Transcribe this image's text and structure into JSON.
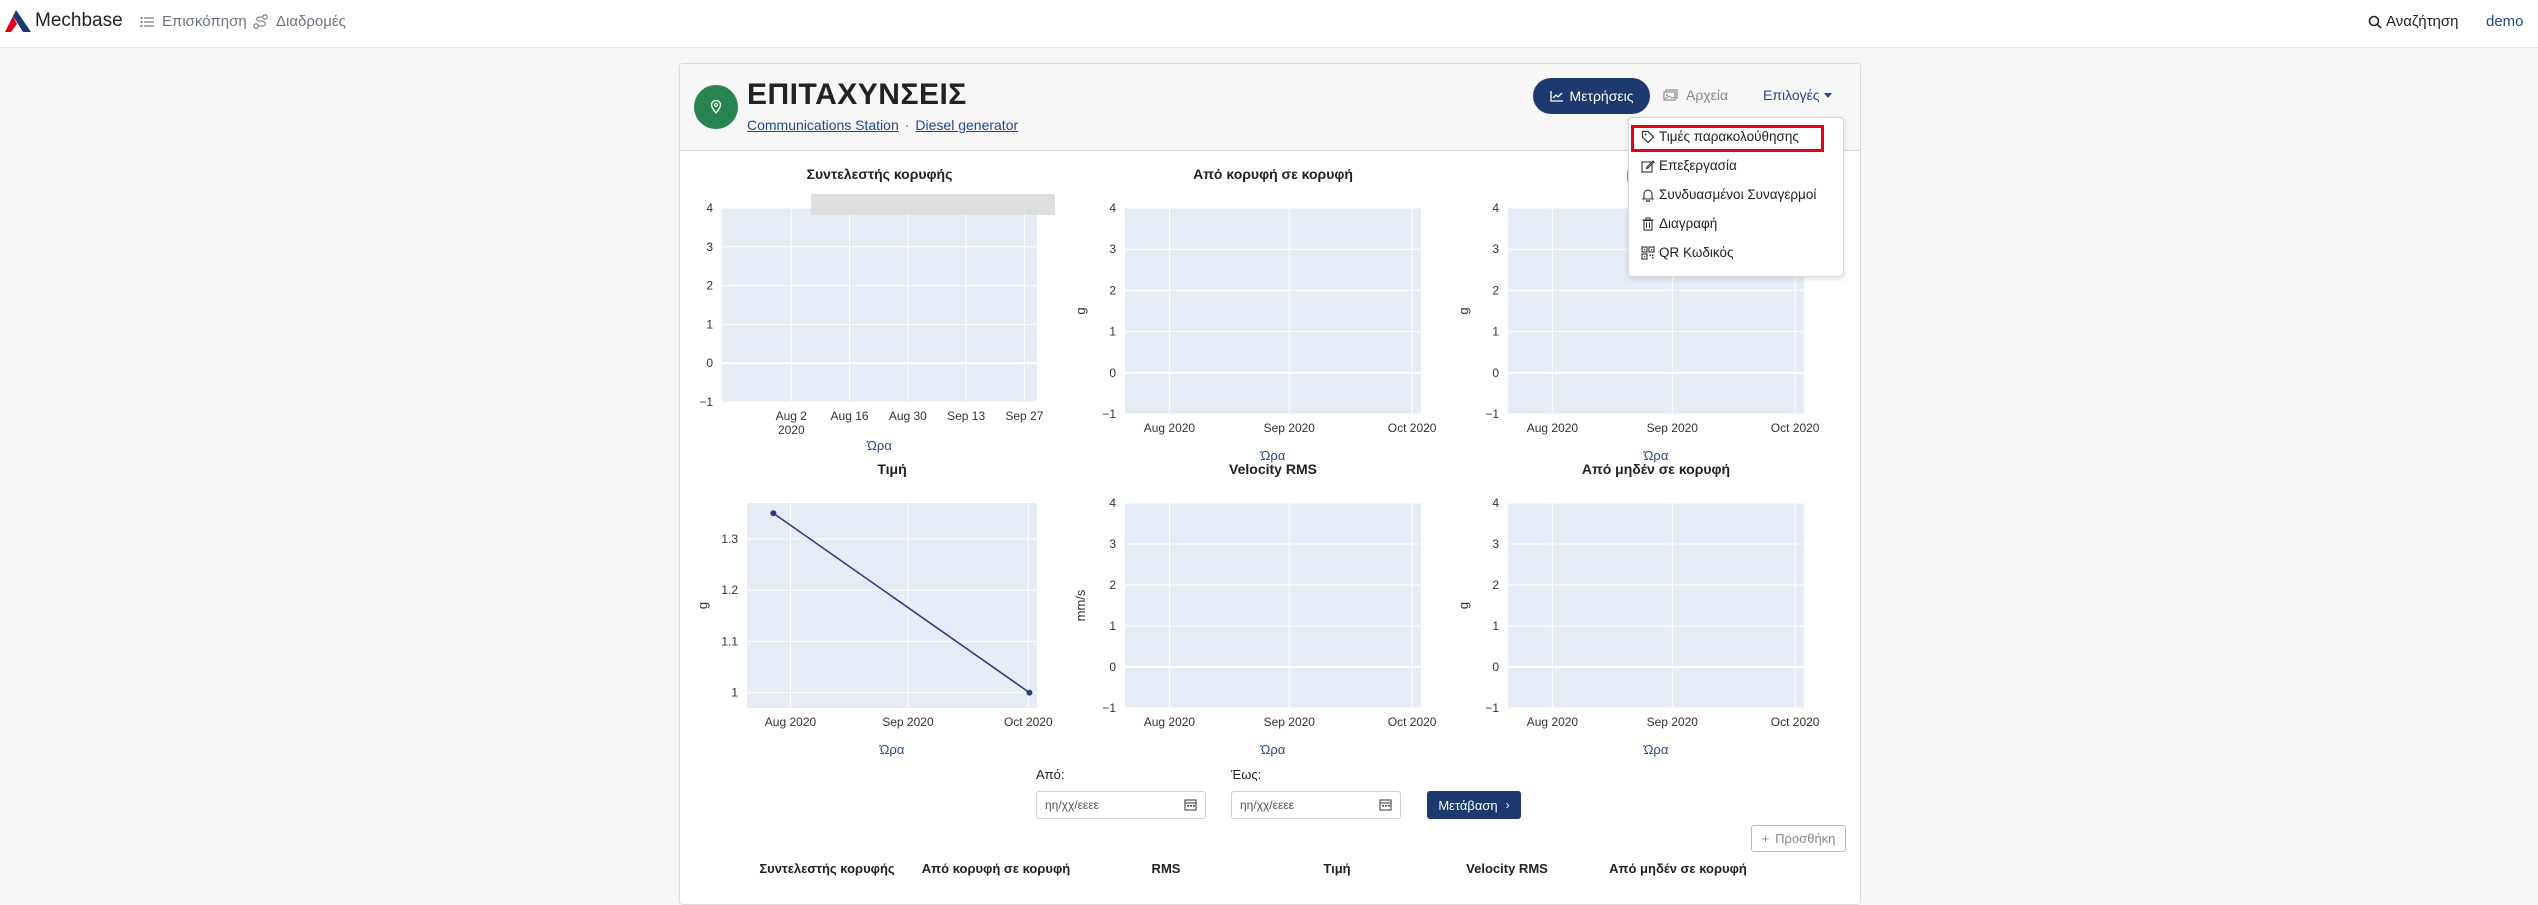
{
  "nav": {
    "brand": "Mechbase",
    "overview": "Επισκόπηση",
    "routes": "Διαδρομές",
    "search": "Αναζήτηση",
    "user": "demo"
  },
  "header": {
    "title": "ΕΠΙΤΑΧΥΝΣΕΙΣ",
    "breadcrumb": [
      "Communications Station",
      "Diesel generator"
    ],
    "separator": "·",
    "measurements_button": "Μετρήσεις",
    "files_button": "Αρχεία",
    "options_button": "Επιλογές"
  },
  "dropdown": {
    "items": [
      {
        "label": "Τιμές παρακολούθησης",
        "icon": "tag-icon"
      },
      {
        "label": "Επεξεργασία",
        "icon": "edit-icon"
      },
      {
        "label": "Συνδυασμένοι Συναγερμοί",
        "icon": "bell-icon"
      },
      {
        "label": "Διαγραφή",
        "icon": "trash-icon"
      },
      {
        "label": "QR Κωδικός",
        "icon": "qr-code-icon"
      }
    ]
  },
  "chart_data": [
    {
      "type": "line",
      "title": "Συντελεστής κορυφής",
      "xlabel": "Ώρα",
      "ylabel": "",
      "xticks": [
        "Aug 2\n2020",
        "Aug 16",
        "Aug 30",
        "Sep 13",
        "Sep 27"
      ],
      "yticks": [
        "−1",
        "0",
        "1",
        "2",
        "3",
        "4"
      ],
      "ylim": [
        -1,
        4
      ],
      "series": []
    },
    {
      "type": "line",
      "title": "Από κορυφή σε κορυφή",
      "xlabel": "Ώρα",
      "ylabel": "g",
      "xticks": [
        "Aug 2020",
        "Sep 2020",
        "Oct 2020"
      ],
      "yticks": [
        "−1",
        "0",
        "1",
        "2",
        "3",
        "4"
      ],
      "ylim": [
        -1,
        4
      ],
      "series": []
    },
    {
      "type": "line",
      "title": "",
      "xlabel": "Ώρα",
      "ylabel": "g",
      "xticks": [
        "Aug 2020",
        "Sep 2020",
        "Oct 2020"
      ],
      "yticks": [
        "−1",
        "0",
        "1",
        "2",
        "3",
        "4"
      ],
      "ylim": [
        -1,
        4
      ],
      "series": []
    },
    {
      "type": "line",
      "title": "Τιμή",
      "xlabel": "Ώρα",
      "ylabel": "g",
      "xticks": [
        "Aug 2020",
        "Sep 2020",
        "Oct 2020"
      ],
      "yticks": [
        "1",
        "1.1",
        "1.2",
        "1.3"
      ],
      "ylim": [
        0.97,
        1.37
      ],
      "series": [
        {
          "x": [
            "2020-07-24",
            "2020-09-30"
          ],
          "y": [
            1.35,
            1.0
          ]
        }
      ]
    },
    {
      "type": "line",
      "title": "Velocity RMS",
      "xlabel": "Ώρα",
      "ylabel": "mm/s",
      "xticks": [
        "Aug 2020",
        "Sep 2020",
        "Oct 2020"
      ],
      "yticks": [
        "−1",
        "0",
        "1",
        "2",
        "3",
        "4"
      ],
      "ylim": [
        -1,
        4
      ],
      "series": []
    },
    {
      "type": "line",
      "title": "Από μηδέν σε κορυφή",
      "xlabel": "Ώρα",
      "ylabel": "g",
      "xticks": [
        "Aug 2020",
        "Sep 2020",
        "Oct 2020"
      ],
      "yticks": [
        "−1",
        "0",
        "1",
        "2",
        "3",
        "4"
      ],
      "ylim": [
        -1,
        4
      ],
      "series": []
    }
  ],
  "filter": {
    "from_label": "Από:",
    "to_label": "Έως:",
    "from_placeholder": "ηη/χχ/εεεε",
    "to_placeholder": "ηη/χχ/εεεε",
    "go_button": "Μετάβαση"
  },
  "add_button": "Προσθήκη",
  "table": {
    "headers": [
      "Συντελεστής κορυφής",
      "Από κορυφή σε κορυφή",
      "RMS",
      "Τιμή",
      "Velocity RMS",
      "Από μηδέν σε κορυφή"
    ]
  },
  "colors": {
    "primary": "#1d3a6e",
    "location_icon": "#28844f",
    "plot_bg": "#e5ecf6",
    "line": "#2a3f7f",
    "highlight": "#e3001b"
  }
}
